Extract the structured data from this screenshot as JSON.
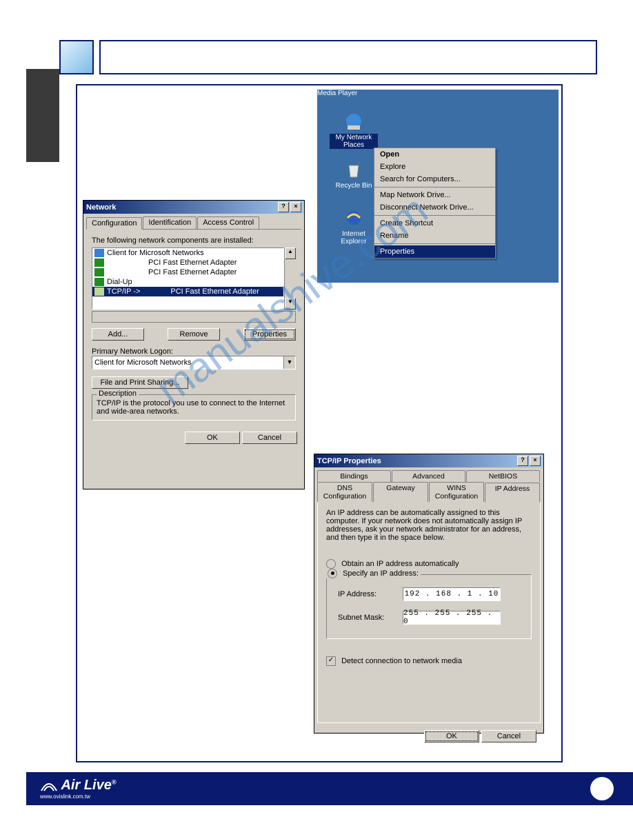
{
  "desktop": {
    "mediaPlayer": "Media Player",
    "icons": {
      "network": "My Network Places",
      "recycle": "Recycle Bin",
      "ie": "Internet Explorer"
    },
    "contextMenu": {
      "open": "Open",
      "explore": "Explore",
      "search": "Search for Computers...",
      "map": "Map Network Drive...",
      "disconnect": "Disconnect Network Drive...",
      "shortcut": "Create Shortcut",
      "rename": "Rename",
      "properties": "Properties"
    }
  },
  "networkDialog": {
    "title": "Network",
    "tabs": {
      "config": "Configuration",
      "ident": "Identification",
      "access": "Access Control"
    },
    "introText": "The following network components are installed:",
    "list": {
      "client": "Client for Microsoft Networks",
      "pci1": "PCI Fast Ethernet Adapter",
      "pci2": "PCI Fast Ethernet Adapter",
      "dialup": "Dial-Up",
      "tcpip": "TCP/IP ->",
      "tcpipAdapter": "PCI Fast Ethernet Adapter"
    },
    "buttons": {
      "add": "Add...",
      "remove": "Remove",
      "properties": "Properties"
    },
    "logonLabel": "Primary Network Logon:",
    "logonValue": "Client for Microsoft Networks",
    "fileShare": "File and Print Sharing...",
    "descGroup": "Description",
    "descText": "TCP/IP is the protocol you use to connect to the Internet and wide-area networks.",
    "ok": "OK",
    "cancel": "Cancel"
  },
  "tcpipDialog": {
    "title": "TCP/IP Properties",
    "tabsRow1": {
      "bindings": "Bindings",
      "advanced": "Advanced",
      "netbios": "NetBIOS"
    },
    "tabsRow2": {
      "dns": "DNS Configuration",
      "gateway": "Gateway",
      "wins": "WINS Configuration",
      "ip": "IP Address"
    },
    "introText": "An IP address can be automatically assigned to this computer. If your network does not automatically assign IP addresses, ask your network administrator for an address, and then type it in the space below.",
    "radio1": "Obtain an IP address automatically",
    "radio2": "Specify an IP address:",
    "ipLabel": "IP Address:",
    "ipValue": "192 . 168 .  1  . 10",
    "maskLabel": "Subnet Mask:",
    "maskValue": "255 . 255 . 255 .  0",
    "detect": "Detect connection to network media",
    "ok": "OK",
    "cancel": "Cancel"
  },
  "footer": {
    "logo": "Air Live",
    "url": "www.ovislink.com.tw"
  },
  "watermark": "manualshive.com"
}
